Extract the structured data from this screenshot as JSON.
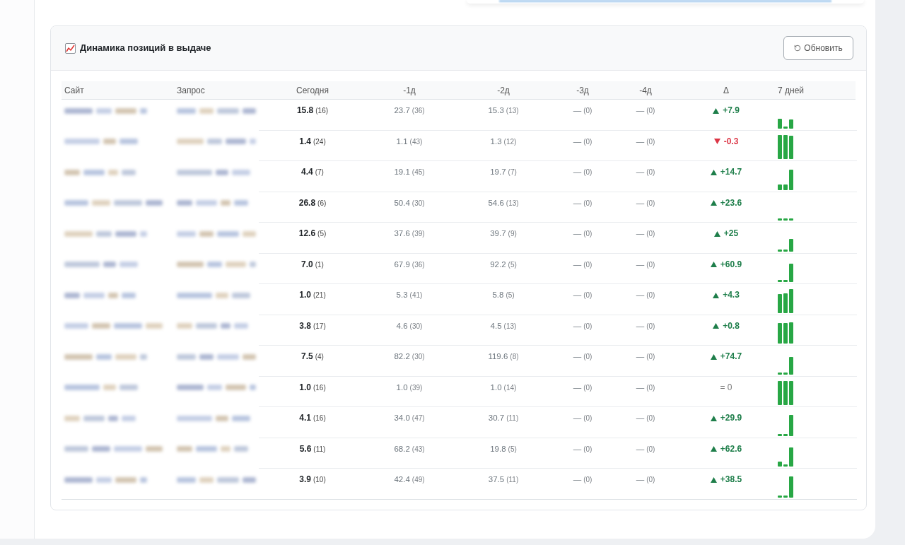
{
  "panel": {
    "title": "Динамика позиций в выдаче",
    "refresh_button": "Обновить"
  },
  "table": {
    "columns": [
      {
        "label": "Сайт",
        "kind": "site"
      },
      {
        "label": "Запрос",
        "kind": "query"
      },
      {
        "label": "Сегодня",
        "kind": "today"
      },
      {
        "label": "-1д",
        "kind": "day"
      },
      {
        "label": "-2д",
        "kind": "day"
      },
      {
        "label": "-3д",
        "kind": "day"
      },
      {
        "label": "-4д",
        "kind": "day"
      },
      {
        "label": "Δ",
        "kind": "delta"
      },
      {
        "label": "7 дней",
        "kind": "trend"
      }
    ],
    "rows": [
      {
        "positions": [
          {
            "value": "15.8",
            "extra": "(16)"
          },
          {
            "value": "23.7",
            "extra": "(36)"
          },
          {
            "value": "15.3",
            "extra": "(13)"
          },
          {
            "value": "—",
            "extra": "(0)"
          },
          {
            "value": "—",
            "extra": "(0)"
          }
        ],
        "delta": {
          "kind": "up",
          "text": "+7.9"
        }
      },
      {
        "positions": [
          {
            "value": "1.4",
            "extra": "(24)"
          },
          {
            "value": "1.1",
            "extra": "(43)"
          },
          {
            "value": "1.3",
            "extra": "(12)"
          },
          {
            "value": "—",
            "extra": "(0)"
          },
          {
            "value": "—",
            "extra": "(0)"
          }
        ],
        "delta": {
          "kind": "down",
          "text": "-0.3"
        }
      },
      {
        "positions": [
          {
            "value": "4.4",
            "extra": "(7)"
          },
          {
            "value": "19.1",
            "extra": "(45)"
          },
          {
            "value": "19.7",
            "extra": "(7)"
          },
          {
            "value": "—",
            "extra": "(0)"
          },
          {
            "value": "—",
            "extra": "(0)"
          }
        ],
        "delta": {
          "kind": "up",
          "text": "+14.7"
        }
      },
      {
        "positions": [
          {
            "value": "26.8",
            "extra": "(6)"
          },
          {
            "value": "50.4",
            "extra": "(30)"
          },
          {
            "value": "54.6",
            "extra": "(13)"
          },
          {
            "value": "—",
            "extra": "(0)"
          },
          {
            "value": "—",
            "extra": "(0)"
          }
        ],
        "delta": {
          "kind": "up",
          "text": "+23.6"
        }
      },
      {
        "positions": [
          {
            "value": "12.6",
            "extra": "(5)"
          },
          {
            "value": "37.6",
            "extra": "(39)"
          },
          {
            "value": "39.7",
            "extra": "(9)"
          },
          {
            "value": "—",
            "extra": "(0)"
          },
          {
            "value": "—",
            "extra": "(0)"
          }
        ],
        "delta": {
          "kind": "up",
          "text": "+25"
        }
      },
      {
        "positions": [
          {
            "value": "7.0",
            "extra": "(1)"
          },
          {
            "value": "67.9",
            "extra": "(36)"
          },
          {
            "value": "92.2",
            "extra": "(5)"
          },
          {
            "value": "—",
            "extra": "(0)"
          },
          {
            "value": "—",
            "extra": "(0)"
          }
        ],
        "delta": {
          "kind": "up",
          "text": "+60.9"
        }
      },
      {
        "positions": [
          {
            "value": "1.0",
            "extra": "(21)"
          },
          {
            "value": "5.3",
            "extra": "(41)"
          },
          {
            "value": "5.8",
            "extra": "(5)"
          },
          {
            "value": "—",
            "extra": "(0)"
          },
          {
            "value": "—",
            "extra": "(0)"
          }
        ],
        "delta": {
          "kind": "up",
          "text": "+4.3"
        }
      },
      {
        "positions": [
          {
            "value": "3.8",
            "extra": "(17)"
          },
          {
            "value": "4.6",
            "extra": "(30)"
          },
          {
            "value": "4.5",
            "extra": "(13)"
          },
          {
            "value": "—",
            "extra": "(0)"
          },
          {
            "value": "—",
            "extra": "(0)"
          }
        ],
        "delta": {
          "kind": "up",
          "text": "+0.8"
        }
      },
      {
        "positions": [
          {
            "value": "7.5",
            "extra": "(4)"
          },
          {
            "value": "82.2",
            "extra": "(30)"
          },
          {
            "value": "119.6",
            "extra": "(8)"
          },
          {
            "value": "—",
            "extra": "(0)"
          },
          {
            "value": "—",
            "extra": "(0)"
          }
        ],
        "delta": {
          "kind": "up",
          "text": "+74.7"
        }
      },
      {
        "positions": [
          {
            "value": "1.0",
            "extra": "(16)"
          },
          {
            "value": "1.0",
            "extra": "(39)"
          },
          {
            "value": "1.0",
            "extra": "(14)"
          },
          {
            "value": "—",
            "extra": "(0)"
          },
          {
            "value": "—",
            "extra": "(0)"
          }
        ],
        "delta": {
          "kind": "flat",
          "text": "= 0"
        }
      },
      {
        "positions": [
          {
            "value": "4.1",
            "extra": "(16)"
          },
          {
            "value": "34.0",
            "extra": "(47)"
          },
          {
            "value": "30.7",
            "extra": "(11)"
          },
          {
            "value": "—",
            "extra": "(0)"
          },
          {
            "value": "—",
            "extra": "(0)"
          }
        ],
        "delta": {
          "kind": "up",
          "text": "+29.9"
        }
      },
      {
        "positions": [
          {
            "value": "5.6",
            "extra": "(11)"
          },
          {
            "value": "68.2",
            "extra": "(43)"
          },
          {
            "value": "19.8",
            "extra": "(5)"
          },
          {
            "value": "—",
            "extra": "(0)"
          },
          {
            "value": "—",
            "extra": "(0)"
          }
        ],
        "delta": {
          "kind": "up",
          "text": "+62.6"
        }
      },
      {
        "positions": [
          {
            "value": "3.9",
            "extra": "(10)"
          },
          {
            "value": "42.4",
            "extra": "(49)"
          },
          {
            "value": "37.5",
            "extra": "(11)"
          },
          {
            "value": "—",
            "extra": "(0)"
          },
          {
            "value": "—",
            "extra": "(0)"
          }
        ],
        "delta": {
          "kind": "up",
          "text": "+38.5"
        }
      }
    ]
  }
}
